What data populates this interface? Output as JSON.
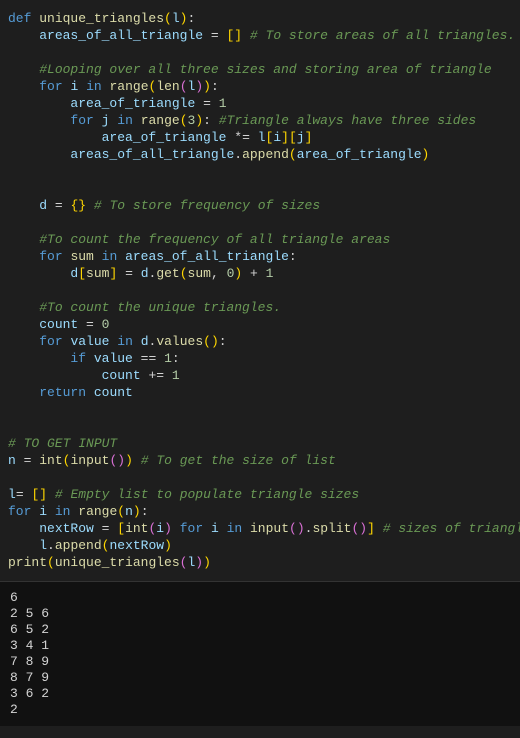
{
  "code": {
    "l1_def": "def",
    "l1_fn": "unique_triangles",
    "l1_param": "l",
    "l2_var": "areas_of_all_triangle",
    "l2_comment": "# To store areas of all triangles.",
    "l4_comment": "#Looping over all three sizes and storing area of triangle",
    "l5_for": "for",
    "l5_i": "i",
    "l5_in": "in",
    "l5_range": "range",
    "l5_len": "len",
    "l5_l": "l",
    "l6_var": "area_of_triangle",
    "l6_val": "1",
    "l7_for": "for",
    "l7_j": "j",
    "l7_in": "in",
    "l7_range": "range",
    "l7_3": "3",
    "l7_comment": "#Triangle always have three sides",
    "l8_var": "area_of_triangle",
    "l8_l": "l",
    "l8_i": "i",
    "l8_j": "j",
    "l9_var": "areas_of_all_triangle",
    "l9_append": "append",
    "l9_arg": "area_of_triangle",
    "l12_d": "d",
    "l12_comment": "# To store frequency of sizes",
    "l14_comment": "#To count the frequency of all triangle areas",
    "l15_for": "for",
    "l15_sum": "sum",
    "l15_in": "in",
    "l15_var": "areas_of_all_triangle",
    "l16_d": "d",
    "l16_sum": "sum",
    "l16_get": "get",
    "l16_0": "0",
    "l16_1": "1",
    "l18_comment": "#To count the unique triangles.",
    "l19_count": "count",
    "l19_0": "0",
    "l20_for": "for",
    "l20_value": "value",
    "l20_in": "in",
    "l20_d": "d",
    "l20_values": "values",
    "l21_if": "if",
    "l21_value": "value",
    "l21_1": "1",
    "l22_count": "count",
    "l22_1": "1",
    "l23_return": "return",
    "l23_count": "count",
    "l26_comment": "# TO GET INPUT",
    "l27_n": "n",
    "l27_int": "int",
    "l27_input": "input",
    "l27_comment": "# To get the size of list",
    "l29_l": "l",
    "l29_comment": "# Empty list to populate triangle sizes",
    "l30_for": "for",
    "l30_i": "i",
    "l30_in": "in",
    "l30_range": "range",
    "l30_n": "n",
    "l31_nextRow": "nextRow",
    "l31_int": "int",
    "l31_i": "i",
    "l31_for": "for",
    "l31_in": "in",
    "l31_input": "input",
    "l31_split": "split",
    "l31_comment": "# sizes of triangles.",
    "l32_l": "l",
    "l32_append": "append",
    "l32_nextRow": "nextRow",
    "l33_print": "print",
    "l33_fn": "unique_triangles",
    "l33_l": "l"
  },
  "output": {
    "o1": "6",
    "o2": "2 5 6",
    "o3": "6 5 2",
    "o4": "3 4 1",
    "o5": "7 8 9",
    "o6": "8 7 9",
    "o7": "3 6 2",
    "o8": "2"
  }
}
